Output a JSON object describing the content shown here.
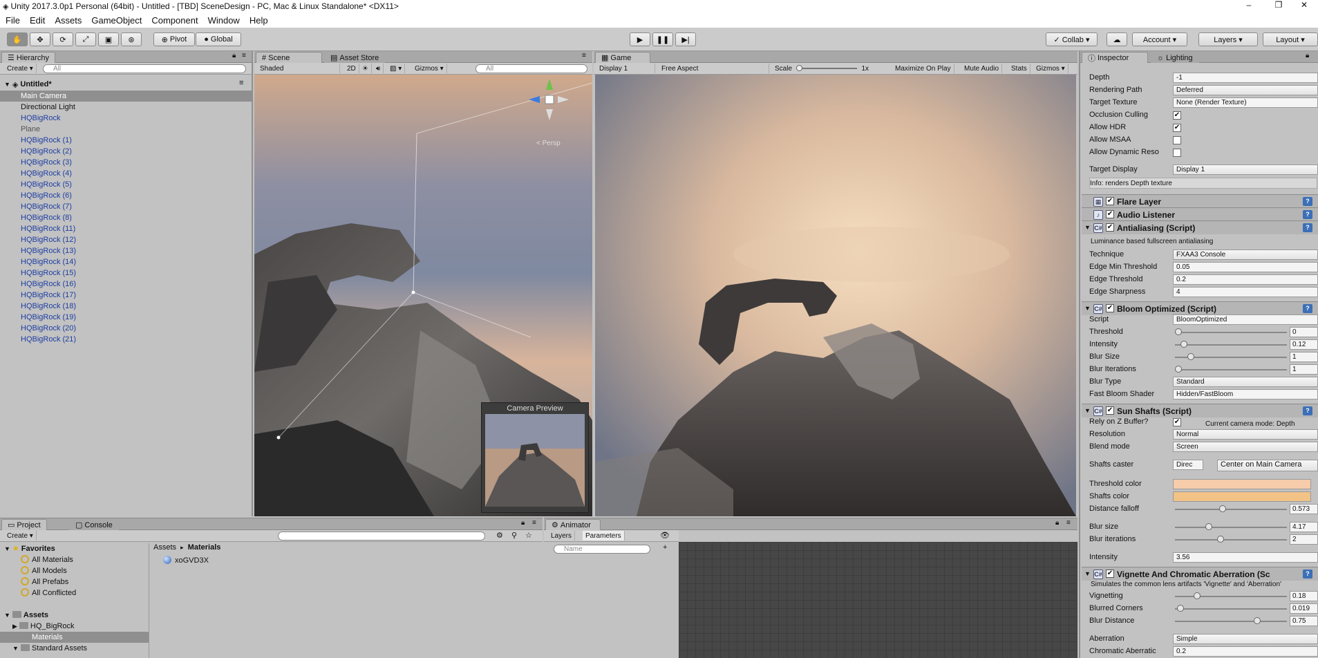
{
  "window": {
    "title": "Unity 2017.3.0p1 Personal (64bit) - Untitled - [TBD] SceneDesign - PC, Mac & Linux Standalone* <DX11>",
    "minimize": "–",
    "maximize": "❐",
    "close": "✕"
  },
  "menu": [
    "File",
    "Edit",
    "Assets",
    "GameObject",
    "Component",
    "Window",
    "Help"
  ],
  "toolbar": {
    "pivot": "Pivot",
    "global": "Global",
    "collab": "Collab ▾",
    "account": "Account ▾",
    "layers": "Layers ▾",
    "layout": "Layout ▾"
  },
  "hierarchy": {
    "tab": "Hierarchy",
    "create": "Create ▾",
    "search_placeholder": "All",
    "scene": "Untitled*",
    "items": [
      {
        "label": "Main Camera",
        "prefab": false,
        "selected": true
      },
      {
        "label": "Directional Light",
        "prefab": false,
        "selected": false
      },
      {
        "label": "HQBigRock",
        "prefab": true
      },
      {
        "label": "Plane",
        "prefab": false,
        "dim": true
      },
      {
        "label": "HQBigRock (1)",
        "prefab": true
      },
      {
        "label": "HQBigRock (2)",
        "prefab": true
      },
      {
        "label": "HQBigRock (3)",
        "prefab": true
      },
      {
        "label": "HQBigRock (4)",
        "prefab": true
      },
      {
        "label": "HQBigRock (5)",
        "prefab": true
      },
      {
        "label": "HQBigRock (6)",
        "prefab": true
      },
      {
        "label": "HQBigRock (7)",
        "prefab": true
      },
      {
        "label": "HQBigRock (8)",
        "prefab": true
      },
      {
        "label": "HQBigRock (11)",
        "prefab": true
      },
      {
        "label": "HQBigRock (12)",
        "prefab": true
      },
      {
        "label": "HQBigRock (13)",
        "prefab": true
      },
      {
        "label": "HQBigRock (14)",
        "prefab": true
      },
      {
        "label": "HQBigRock (15)",
        "prefab": true
      },
      {
        "label": "HQBigRock (16)",
        "prefab": true
      },
      {
        "label": "HQBigRock (17)",
        "prefab": true
      },
      {
        "label": "HQBigRock (18)",
        "prefab": true
      },
      {
        "label": "HQBigRock (19)",
        "prefab": true
      },
      {
        "label": "HQBigRock (20)",
        "prefab": true
      },
      {
        "label": "HQBigRock (21)",
        "prefab": true
      }
    ]
  },
  "scene": {
    "tab_scene": "Scene",
    "tab_store": "Asset Store",
    "shading": "Shaded",
    "mode2d": "2D",
    "gizmos": "Gizmos ▾",
    "search_placeholder": "All",
    "persp": "< Persp",
    "camera_preview": "Camera Preview"
  },
  "game": {
    "tab": "Game",
    "display": "Display 1",
    "aspect": "Free Aspect",
    "scale_label": "Scale",
    "scale_value": "1x",
    "maximize": "Maximize On Play",
    "mute": "Mute Audio",
    "stats": "Stats",
    "gizmos": "Gizmos ▾"
  },
  "inspector": {
    "tab": "Inspector",
    "tab_lighting": "Lighting",
    "camera_rows": [
      {
        "label": "Depth",
        "value": "-1"
      },
      {
        "label": "Rendering Path",
        "value": "Deferred"
      },
      {
        "label": "Target Texture",
        "value": "None (Render Texture)"
      }
    ],
    "checks": [
      {
        "label": "Occlusion Culling",
        "mark": "✔"
      },
      {
        "label": "Allow HDR",
        "mark": "✔"
      },
      {
        "label": "Allow MSAA",
        "mark": ""
      },
      {
        "label": "Allow Dynamic Reso",
        "mark": ""
      }
    ],
    "target_display": {
      "label": "Target Display",
      "value": "Display 1"
    },
    "info_depth": "Info: renders Depth texture",
    "components": {
      "flare": "Flare Layer",
      "audio": "Audio Listener",
      "aa": "Antialiasing (Script)",
      "bloom": "Bloom Optimized (Script)",
      "sun": "Sun Shafts (Script)",
      "vignette": "Vignette And Chromatic Aberration (Sc"
    },
    "aa_desc": "Luminance based fullscreen antialiasing",
    "aa_rows": [
      {
        "label": "Technique",
        "value": "FXAA3 Console"
      },
      {
        "label": "Edge Min Threshold",
        "value": "0.05"
      },
      {
        "label": "Edge Threshold",
        "value": "0.2"
      },
      {
        "label": "Edge Sharpness",
        "value": "4"
      }
    ],
    "bloom_script": {
      "label": "Script",
      "value": "BloomOptimized"
    },
    "bloom_sliders": [
      {
        "label": "Threshold",
        "value": "0",
        "pos": 0.0
      },
      {
        "label": "Intensity",
        "value": "0.12",
        "pos": 0.05
      },
      {
        "label": "Blur Size",
        "value": "1",
        "pos": 0.12
      },
      {
        "label": "Blur Iterations",
        "value": "1",
        "pos": 0.0
      }
    ],
    "bloom_rows": [
      {
        "label": "Blur Type",
        "value": "Standard"
      },
      {
        "label": "Fast Bloom Shader",
        "value": "Hidden/FastBloom"
      }
    ],
    "sun": {
      "rely_label": "Rely on Z Buffer?",
      "rely_mark": "✔",
      "camera_mode": "Current camera mode: Depth",
      "resolution": {
        "label": "Resolution",
        "value": "Normal"
      },
      "blend": {
        "label": "Blend mode",
        "value": "Screen"
      },
      "caster_label": "Shafts caster",
      "caster_value": "Direc",
      "center_btn": "Center on Main Camera",
      "threshold_color": {
        "label": "Threshold color",
        "color": "#f6ccab"
      },
      "shafts_color": {
        "label": "Shafts color",
        "color": "#f2c287"
      },
      "sliders": [
        {
          "label": "Distance falloff",
          "value": "0.573",
          "pos": 0.42
        },
        {
          "label": "Blur size",
          "value": "4.17",
          "pos": 0.29
        },
        {
          "label": "Blur iterations",
          "value": "2",
          "pos": 0.4
        }
      ],
      "intensity": {
        "label": "Intensity",
        "value": "3.56"
      }
    },
    "vignette_desc": "Simulates the common lens artifacts 'Vignette' and 'Aberration'",
    "vignette_sliders": [
      {
        "label": "Vignetting",
        "value": "0.18",
        "pos": 0.18
      },
      {
        "label": "Blurred Corners",
        "value": "0.019",
        "pos": 0.02
      },
      {
        "label": "Blur Distance",
        "value": "0.75",
        "pos": 0.75
      }
    ],
    "aberration": {
      "label": "Aberration",
      "value": "Simple"
    },
    "chromatic": {
      "label": "Chromatic Aberratic",
      "value": "0.2"
    }
  },
  "project": {
    "tab": "Project",
    "tab_console": "Console",
    "create": "Create ▾",
    "favorites": "Favorites",
    "favorite_items": [
      "All Materials",
      "All Models",
      "All Prefabs",
      "All Conflicted"
    ],
    "assets": "Assets",
    "asset_folders": [
      "HQ_BigRock",
      "Materials",
      "Standard Assets"
    ],
    "breadcrumb_root": "Assets",
    "breadcrumb_sep": "▸",
    "breadcrumb_leaf": "Materials",
    "file": "xoGVD3X"
  },
  "animator": {
    "tab": "Animator",
    "layers": "Layers",
    "parameters": "Parameters",
    "search_placeholder": "Name"
  },
  "colors": {
    "prefab_text": "#1c3da3",
    "selection": "#8f8f8f",
    "panel": "#c2c2c2",
    "animator_grid": "#474747"
  }
}
